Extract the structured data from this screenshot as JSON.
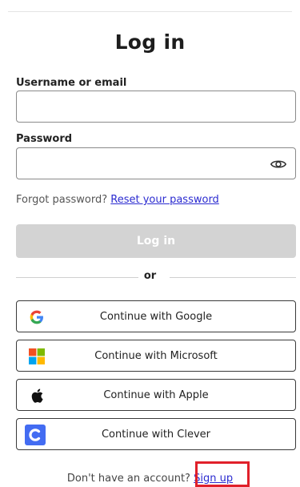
{
  "page": {
    "title": "Log in"
  },
  "form": {
    "username_label": "Username or email",
    "username_value": "",
    "password_label": "Password",
    "password_value": "",
    "forgot_prefix": "Forgot password?",
    "reset_link": "Reset your password",
    "login_button": "Log in",
    "divider": "or"
  },
  "sso": [
    {
      "label": "Continue with Google",
      "icon": "google-icon"
    },
    {
      "label": "Continue with Microsoft",
      "icon": "microsoft-icon"
    },
    {
      "label": "Continue with Apple",
      "icon": "apple-icon"
    },
    {
      "label": "Continue with Clever",
      "icon": "clever-icon"
    }
  ],
  "footer": {
    "prompt": "Don't have an account?",
    "signup_link": "Sign up"
  },
  "colors": {
    "link": "#2b2bd0",
    "disabled_button": "#d3d3d3",
    "highlight": "#e0202a",
    "clever": "#436cf2"
  }
}
